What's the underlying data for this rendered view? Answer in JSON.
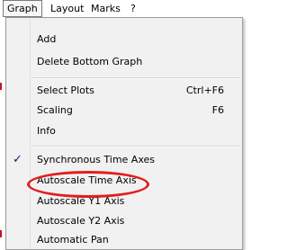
{
  "menubar": {
    "items": [
      {
        "label": "Graph"
      },
      {
        "label": "Layout"
      },
      {
        "label": "Marks"
      },
      {
        "label": "?"
      }
    ]
  },
  "graph_menu": {
    "items": [
      {
        "label": "Add",
        "shortcut": ""
      },
      {
        "label": "Delete Bottom Graph",
        "shortcut": ""
      },
      {
        "label": "Select Plots",
        "shortcut": "Ctrl+F6"
      },
      {
        "label": "Scaling",
        "shortcut": "F6"
      },
      {
        "label": "Info",
        "shortcut": ""
      },
      {
        "label": "Synchronous Time Axes",
        "shortcut": "",
        "checked": true
      },
      {
        "label": "Autoscale Time Axis",
        "shortcut": "",
        "highlighted": true
      },
      {
        "label": "Autoscale Y1 Axis",
        "shortcut": ""
      },
      {
        "label": "Autoscale Y2 Axis",
        "shortcut": ""
      },
      {
        "label": "Automatic Pan",
        "shortcut": ""
      }
    ]
  },
  "icons": {
    "check": "checkmark-icon"
  },
  "colors": {
    "highlight_ellipse": "#e01f1f",
    "menu_bg": "#f1f1f1"
  }
}
